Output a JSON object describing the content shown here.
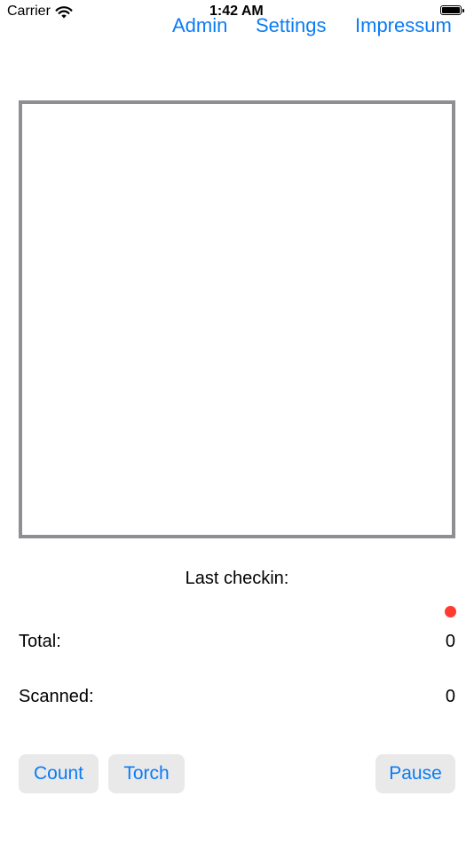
{
  "status_bar": {
    "carrier": "Carrier",
    "time": "1:42 AM",
    "icons": [
      "wifi-icon",
      "battery-icon"
    ]
  },
  "nav": {
    "admin": "Admin",
    "settings": "Settings",
    "impressum": "Impressum"
  },
  "main": {
    "last_checkin_label": "Last checkin:",
    "status_color": "#ff3b30",
    "total_label": "Total:",
    "total_value": "0",
    "scanned_label": "Scanned:",
    "scanned_value": "0"
  },
  "buttons": {
    "count": "Count",
    "torch": "Torch",
    "pause": "Pause"
  },
  "colors": {
    "accent": "#0a7cf5",
    "frame": "#8e8e93",
    "button_bg": "#e9e9ea"
  }
}
